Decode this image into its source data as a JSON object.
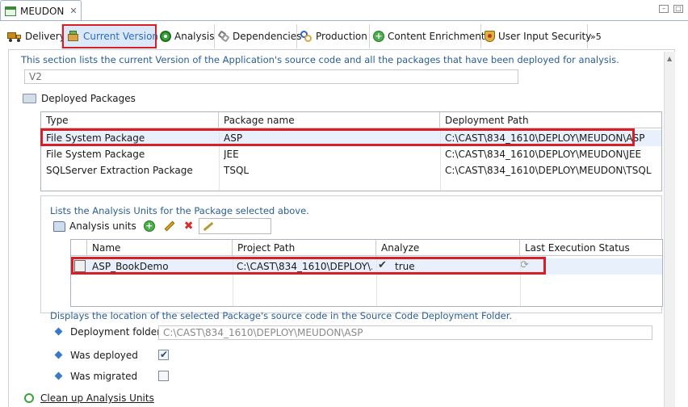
{
  "editor": {
    "tab_title": "MEUDON"
  },
  "toolbar": {
    "tabs": [
      {
        "label": "Delivery",
        "icon": "truck-icon"
      },
      {
        "label": "Current Version",
        "icon": "version-package-icon"
      },
      {
        "label": "Analysis",
        "icon": "analysis-gear-icon"
      },
      {
        "label": "Dependencies",
        "icon": "dependencies-icon"
      },
      {
        "label": "Production",
        "icon": "production-icon"
      },
      {
        "label": "Content Enrichment",
        "icon": "plus-circle-icon"
      },
      {
        "label": "User Input Security",
        "icon": "shield-icon"
      }
    ],
    "overflow": "»5"
  },
  "current_version": {
    "description": "This section lists the current Version of the Application's source code and all the packages that have been deployed for analysis.",
    "version_value": "V2"
  },
  "deployed_packages": {
    "title": "Deployed Packages",
    "columns": [
      "Type",
      "Package name",
      "Deployment Path"
    ],
    "rows": [
      {
        "type": "File System Package",
        "name": "ASP",
        "path": "C:\\CAST\\834_1610\\DEPLOY\\MEUDON\\ASP"
      },
      {
        "type": "File System Package",
        "name": "JEE",
        "path": "C:\\CAST\\834_1610\\DEPLOY\\MEUDON\\JEE"
      },
      {
        "type": "SQLServer Extraction Package",
        "name": "TSQL",
        "path": "C:\\CAST\\834_1610\\DEPLOY\\MEUDON\\TSQL"
      }
    ]
  },
  "analysis_units": {
    "description": "Lists the Analysis Units for the Package selected above.",
    "title": "Analysis units",
    "columns": [
      "Name",
      "Project Path",
      "Analyze",
      "Last Execution Status"
    ],
    "rows": [
      {
        "name": "ASP_BookDemo",
        "path": "C:\\CAST\\834_1610\\DEPLOY\\...",
        "analyze": "true"
      }
    ]
  },
  "location": {
    "description": "Displays the location of the selected Package's source code in the Source Code Deployment Folder.",
    "deployment_folder_label": "Deployment folder",
    "deployment_folder_value": "C:\\CAST\\834_1610\\DEPLOY\\MEUDON\\ASP",
    "was_deployed_label": "Was deployed",
    "was_deployed": true,
    "was_migrated_label": "Was migrated",
    "was_migrated": false
  },
  "cleanup": {
    "label": "Clean up Analysis Units"
  },
  "colors": {
    "highlight": "#d81f26",
    "link_blue": "#2b5d96",
    "active_tab_bg": "#dbe8f8"
  }
}
